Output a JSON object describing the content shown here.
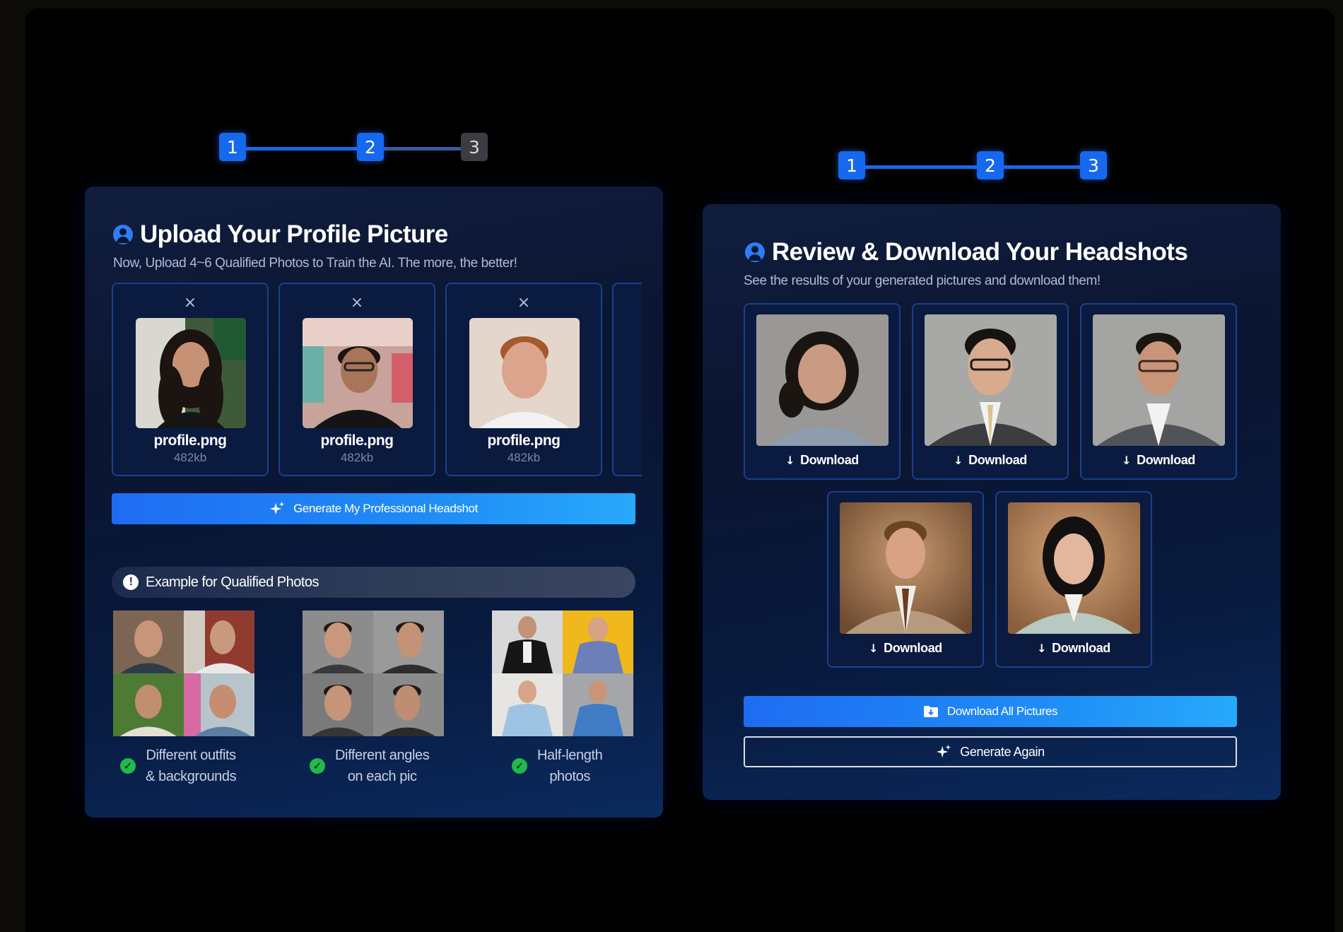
{
  "left_stepper": {
    "steps": [
      "1",
      "2",
      "3"
    ]
  },
  "right_stepper": {
    "steps": [
      "1",
      "2",
      "3"
    ]
  },
  "upload_panel": {
    "title": "Upload Your Profile Picture",
    "subtitle": "Now, Upload 4~6 Qualified Photos to Train the AI. The more, the better!",
    "close_glyph": "×",
    "cards": [
      {
        "filename": "profile.png",
        "size": "482kb"
      },
      {
        "filename": "profile.png",
        "size": "482kb"
      },
      {
        "filename": "profile.png",
        "size": "482kb"
      }
    ],
    "generate_button": "Generate My Professional Headshot",
    "example_title": "Example for Qualified Photos",
    "examples": [
      {
        "line1": "Different outfits",
        "line2": "& backgrounds"
      },
      {
        "line1": "Different angles",
        "line2": "on each pic"
      },
      {
        "line1": "Half-length",
        "line2": "photos"
      }
    ]
  },
  "review_panel": {
    "title": "Review & Download Your Headshots",
    "subtitle": "See the results of your generated pictures and download them!",
    "download_label": "Download",
    "download_arrow": "↓",
    "download_all_button": "Download All Pictures",
    "generate_again_button": "Generate Again"
  },
  "colors": {
    "accent_blue": "#1668ee",
    "panel_bg": "#0a1530",
    "card_border": "#1b3f8f",
    "success_green": "#22b84a"
  }
}
